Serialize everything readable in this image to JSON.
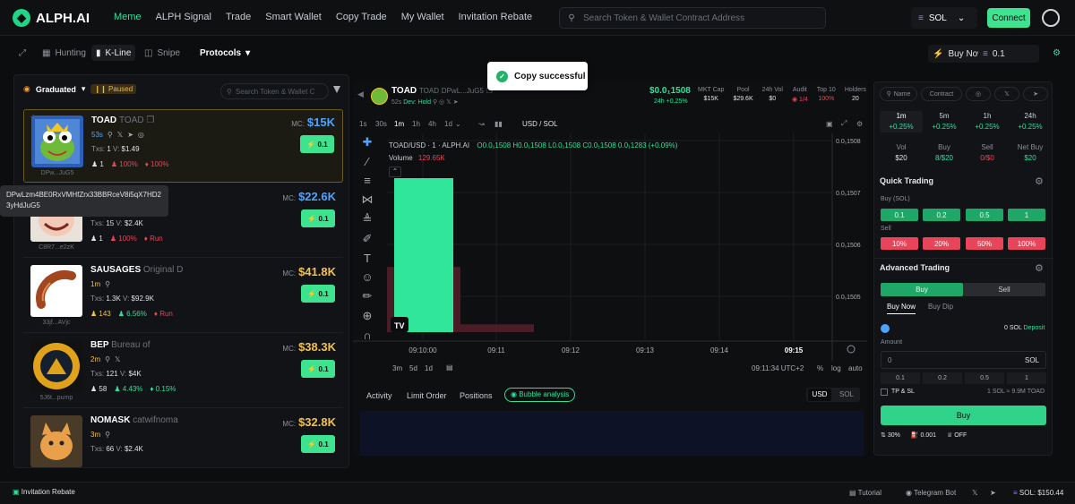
{
  "brand": {
    "name": "ALPH.AI"
  },
  "nav": {
    "items": [
      "Meme",
      "ALPH Signal",
      "Trade",
      "Smart Wallet",
      "Copy Trade",
      "My Wallet",
      "Invitation Rebate"
    ],
    "active": "Meme"
  },
  "search": {
    "placeholder": "Search Token & Wallet Contract Address"
  },
  "chain": {
    "label": "SOL"
  },
  "connect_label": "Connect",
  "subnav": {
    "hunting": "Hunting",
    "kline": "K-Line",
    "snipe": "Snipe",
    "protocols": "Protocols",
    "buy_now": "Buy Now",
    "buy_amount": "0.1"
  },
  "left": {
    "graduated": "Graduated",
    "paused": "Paused",
    "search_placeholder": "Search Token & Wallet C",
    "tooltip": "DPwLzm4BE0RxVMHfZrx33BBRceV8i5qX7HD23yHdJuG5",
    "tokens": [
      {
        "symbol": "TOAD",
        "name": "TOAD",
        "age": "53s",
        "txs": "1",
        "vol": "$1.49",
        "holders": "1",
        "p1": "100%",
        "p2": "100%",
        "mc": "$15K",
        "buy": "0.1",
        "addr": "DPw...JuG5",
        "mc_color": "#4ea3ff"
      },
      {
        "symbol": "",
        "name": "",
        "age": "",
        "txs": "15",
        "vol": "$2.4K",
        "holders": "1",
        "p1": "100%",
        "p2": "Run",
        "mc": "$22.6K",
        "buy": "0.1",
        "addr": "C8R7...e2zK",
        "mc_color": "#4ea3ff"
      },
      {
        "symbol": "SAUSAGES",
        "name": "Original D",
        "age": "1m",
        "txs": "1.3K",
        "vol": "$92.9K",
        "holders": "143",
        "p1": "6.56%",
        "p2": "Run",
        "mc": "$41.8K",
        "buy": "0.1",
        "addr": "33jf...AVjc",
        "mc_color": "#f2c14a"
      },
      {
        "symbol": "BEP",
        "name": "Bureau of",
        "age": "2m",
        "txs": "121",
        "vol": "$4K",
        "holders": "58",
        "p1": "4.43%",
        "p2": "0.15%",
        "mc": "$38.3K",
        "buy": "0.1",
        "addr": "5J6t...pump",
        "mc_color": "#f2c14a"
      },
      {
        "symbol": "NOMASK",
        "name": "catwifnoma",
        "age": "3m",
        "txs": "66",
        "vol": "$2.4K",
        "holders": "",
        "p1": "",
        "p2": "",
        "mc": "$32.8K",
        "buy": "0.1",
        "addr": "",
        "mc_color": "#f2c14a"
      }
    ],
    "labels": {
      "mc": "MC:",
      "txs": "Txs:",
      "v": "V:"
    }
  },
  "toast": "Copy successful",
  "pair": {
    "symbol": "TOAD",
    "name": "TOAD",
    "addr": "DPwL...JuG5",
    "age": "52s",
    "dev": "Dev: Hold",
    "price": "$0.0₁1508",
    "change": "24h +0.25%",
    "stats": [
      {
        "k": "MKT Cap",
        "v": "$15K"
      },
      {
        "k": "Pool",
        "v": "$29.6K"
      },
      {
        "k": "24h Vol",
        "v": "$0"
      },
      {
        "k": "Audit",
        "v": "1/4"
      },
      {
        "k": "Top 10",
        "v": "100%"
      },
      {
        "k": "Holders",
        "v": "20"
      }
    ]
  },
  "chart_toolbar": {
    "intervals": [
      "1s",
      "30s",
      "1m",
      "1h",
      "4h",
      "1d"
    ],
    "active": "1m",
    "currency": "USD / SOL"
  },
  "chart_data": {
    "type": "bar",
    "title": "TOAD/USD · 1 · ALPH.AI",
    "ohlc": "O0.0₁1508 H0.0₁1508 L0.0₁1508 C0.0₁1508 0.0₁1283 (+0.09%)",
    "volume_label": "Volume",
    "volume_value": "129.65K",
    "y_ticks": [
      "0.0₁1508",
      "0.0₁1507",
      "0.0₁1506",
      "0.0₁1505"
    ],
    "x_ticks": [
      "09:10:00",
      "09:11",
      "09:12",
      "09:13",
      "09:14",
      "09:15"
    ],
    "volume_bars": [
      {
        "x": "09:10:00",
        "value": 129.65,
        "color": "#2fe69a"
      }
    ],
    "background_bars": [
      {
        "x": "09:10",
        "value": 0.25
      },
      {
        "x": "09:11",
        "value": 0.03
      }
    ]
  },
  "chart_ctrl": {
    "ranges": [
      "3m",
      "5d",
      "1d"
    ],
    "time": "09:11:34 UTC+2",
    "pct": "%",
    "log": "log",
    "auto": "auto"
  },
  "bottom_tabs": {
    "tabs": [
      "Activity",
      "Limit Order",
      "Positions"
    ],
    "bubble": "Bubble analysis",
    "usd": "USD",
    "sol": "SOL"
  },
  "right": {
    "name_filter": "Name",
    "contract_filter": "Contract",
    "tf": [
      {
        "t": "1m",
        "c": "+0.25%"
      },
      {
        "t": "5m",
        "c": "+0.25%"
      },
      {
        "t": "1h",
        "c": "+0.25%"
      },
      {
        "t": "24h",
        "c": "+0.25%"
      }
    ],
    "flow": [
      {
        "k": "Vol",
        "v": "$20"
      },
      {
        "k": "Buy",
        "v": "8/$20"
      },
      {
        "k": "Sell",
        "v": "0/$0"
      },
      {
        "k": "Net Buy",
        "v": "$20"
      }
    ],
    "quick": "Quick Trading",
    "buy_sol": "Buy (SOL)",
    "buy_vals": [
      "0.1",
      "0.2",
      "0.5",
      "1"
    ],
    "sell": "Sell",
    "sell_vals": [
      "10%",
      "20%",
      "50%",
      "100%"
    ],
    "advanced": "Advanced Trading",
    "buy_tab": "Buy",
    "sell_tab": "Sell",
    "buy_now": "Buy Now",
    "buy_dip": "Buy Dip",
    "balance": "0 SOL",
    "deposit": "Deposit",
    "amount": "Amount",
    "amount_val": "0",
    "amount_unit": "SOL",
    "presets": [
      "0.1",
      "0.2",
      "0.5",
      "1"
    ],
    "tpsl": "TP & SL",
    "rate": "1 SOL ≈ 9.9M TOAD",
    "buy_button": "Buy",
    "slip": "30%",
    "fee": "0.001",
    "mev": "OFF"
  },
  "bottom": {
    "invite": "Invitation Rebate",
    "tutorial": "Tutorial",
    "telegram": "Telegram Bot",
    "sol_price": "SOL: $150.44"
  }
}
